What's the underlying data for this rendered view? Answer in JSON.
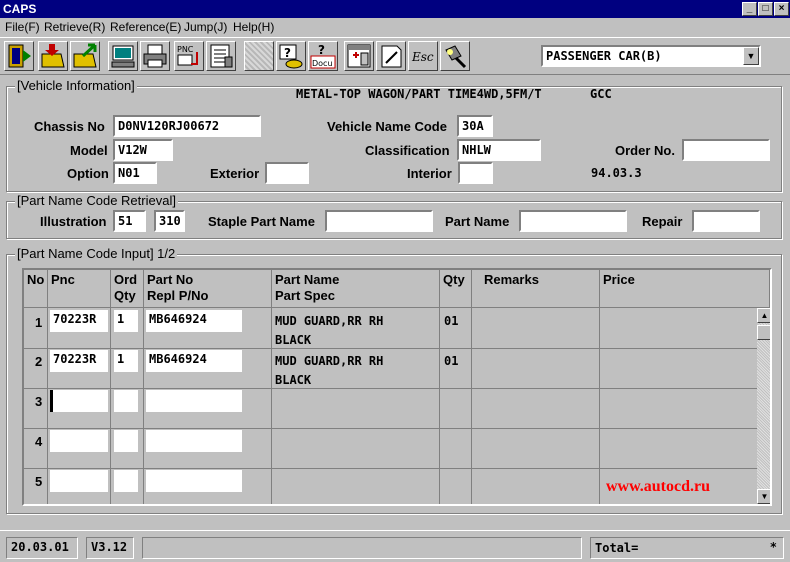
{
  "window": {
    "title": "CAPS"
  },
  "menu": {
    "items": [
      {
        "label": "File(F)"
      },
      {
        "label": "Retrieve(R)"
      },
      {
        "label": "Reference(E)"
      },
      {
        "label": "Jump(J)"
      },
      {
        "label": "Help(H)"
      }
    ]
  },
  "toolbar": {
    "pnc_label": "PNC",
    "docu_label": "Docu",
    "esc_label": "Esc",
    "vehicle_type": "PASSENGER CAR(B)"
  },
  "vehicle_info": {
    "title": "[Vehicle Information]",
    "description": "METAL-TOP WAGON/PART TIME4WD,5FM/T",
    "region": "GCC",
    "chassis_label": "Chassis No",
    "chassis_value": "D0NV120RJ00672",
    "vehicle_code_label": "Vehicle Name Code",
    "vehicle_code_value": "30A",
    "model_label": "Model",
    "model_value": "V12W",
    "classification_label": "Classification",
    "classification_value": "NHLW",
    "order_label": "Order No.",
    "order_value": "",
    "option_label": "Option",
    "option_value": "N01",
    "exterior_label": "Exterior",
    "exterior_value": "",
    "interior_label": "Interior",
    "interior_value": "",
    "date": "94.03.3"
  },
  "retrieval": {
    "title": "[Part Name Code Retrieval]",
    "illustration_label": "Illustration",
    "illustration_a": "51",
    "illustration_b": "310",
    "staple_label": "Staple Part Name",
    "staple_value": "",
    "part_name_label": "Part Name",
    "part_name_value": "",
    "repair_label": "Repair",
    "repair_value": ""
  },
  "input": {
    "title": "[Part Name Code Input] 1/2",
    "columns": {
      "no": "No",
      "pnc": "Pnc",
      "ord": "Ord",
      "qty1": "Qty",
      "partno": "Part No",
      "repl": "Repl P/No",
      "partname": "Part Name",
      "partspec": "Part Spec",
      "qty": "Qty",
      "remarks": "Remarks",
      "price": "Price"
    },
    "rows": [
      {
        "no": "1",
        "pnc": "70223R",
        "ord_qty": "1",
        "part_no": "MB646924",
        "part_name": "MUD GUARD,RR RH",
        "part_spec": "BLACK",
        "qty": "01"
      },
      {
        "no": "2",
        "pnc": "70223R",
        "ord_qty": "1",
        "part_no": "MB646924",
        "part_name": "MUD GUARD,RR RH",
        "part_spec": "BLACK",
        "qty": "01"
      },
      {
        "no": "3",
        "pnc": "",
        "ord_qty": "",
        "part_no": "",
        "part_name": "",
        "part_spec": "",
        "qty": ""
      },
      {
        "no": "4",
        "pnc": "",
        "ord_qty": "",
        "part_no": "",
        "part_name": "",
        "part_spec": "",
        "qty": ""
      },
      {
        "no": "5",
        "pnc": "",
        "ord_qty": "",
        "part_no": "",
        "part_name": "",
        "part_spec": "",
        "qty": ""
      }
    ],
    "watermark": "www.autocd.ru"
  },
  "status": {
    "date": "20.03.01",
    "version": "V3.12",
    "message": "",
    "total_label": "Total=",
    "total_value": "*"
  },
  "colors": {
    "titlebar": "#000080",
    "watermark": "#ff0000"
  }
}
